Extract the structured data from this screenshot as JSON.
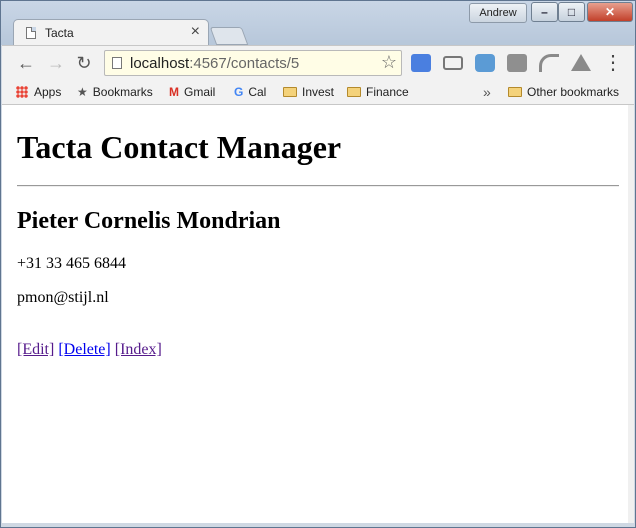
{
  "window": {
    "user": "Andrew",
    "controls": {
      "minimize": "–",
      "maximize": "□",
      "close": "✕"
    }
  },
  "tab": {
    "title": "Tacta",
    "close": "×"
  },
  "toolbar": {
    "back": "←",
    "forward": "→",
    "reload": "↻",
    "url_host": "localhost",
    "url_path": ":4567/contacts/5",
    "star": "☆",
    "menu": "⋮"
  },
  "bookmarks": {
    "items": [
      "Apps",
      "Bookmarks",
      "Gmail",
      "Cal",
      "Invest",
      "Finance"
    ],
    "overflow": "»",
    "other": "Other bookmarks"
  },
  "page": {
    "heading": "Tacta Contact Manager",
    "contact_name": "Pieter Cornelis Mondrian",
    "phone": "+31 33 465 6844",
    "email": "pmon@stijl.nl",
    "links": {
      "edit": "[Edit]",
      "delete": "[Delete]",
      "index": "[Index]"
    }
  },
  "colors": {
    "link_visited": "#551a8b",
    "link_unvisited": "#0000ee",
    "omnibox_bg": "#fffde6"
  }
}
